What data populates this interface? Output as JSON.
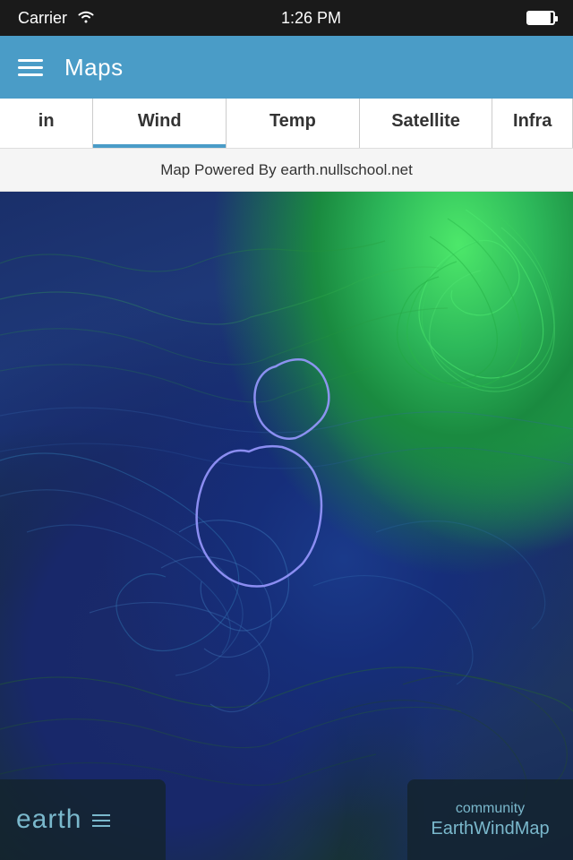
{
  "status_bar": {
    "carrier": "Carrier",
    "time": "1:26 PM"
  },
  "header": {
    "title": "Maps",
    "menu_icon": "hamburger"
  },
  "tabs": [
    {
      "id": "rain",
      "label": "in",
      "active": false
    },
    {
      "id": "wind",
      "label": "Wind",
      "active": true
    },
    {
      "id": "temp",
      "label": "Temp",
      "active": false
    },
    {
      "id": "satellite",
      "label": "Satellite",
      "active": false
    },
    {
      "id": "infra",
      "label": "Infra",
      "active": false,
      "partial": true
    }
  ],
  "attribution": {
    "text": "Map Powered By earth.nullschool.net"
  },
  "bottom_left": {
    "label": "earth",
    "menu_icon": "lines"
  },
  "bottom_right": {
    "community": "community",
    "app_name": "EarthWindMap"
  }
}
